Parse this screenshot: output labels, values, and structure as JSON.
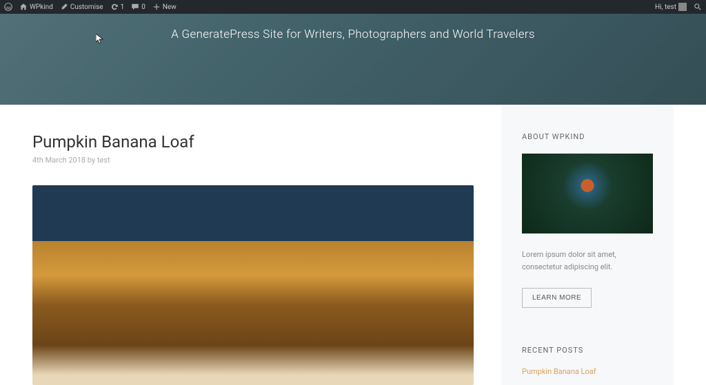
{
  "admin": {
    "site": "WPkind",
    "customise": "Customise",
    "updates": "1",
    "comments": "0",
    "new": "New",
    "greeting": "Hi, test"
  },
  "hero": {
    "tagline": "A GeneratePress Site for Writers, Photographers and World Travelers"
  },
  "post": {
    "title": "Pumpkin Banana Loaf",
    "meta": "4th March 2018 by test"
  },
  "sidebar": {
    "about_title": "ABOUT WPKIND",
    "about_text": "Lorem ipsum dolor sit amet, consectetur adipiscing elit.",
    "learn_more": "LEARN MORE",
    "recent_title": "RECENT POSTS",
    "recent_item": "Pumpkin Banana Loaf"
  }
}
